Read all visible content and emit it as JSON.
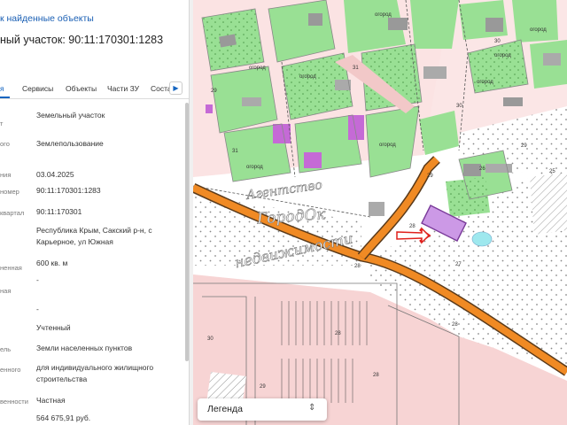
{
  "panel": {
    "back_link": "к найденные объекты",
    "parcel_title": "ный участок: 90:11:170301:1283",
    "tabs": [
      {
        "label": "я"
      },
      {
        "label": "Сервисы"
      },
      {
        "label": "Объекты"
      },
      {
        "label": "Части ЗУ"
      },
      {
        "label": "Соста"
      }
    ],
    "tabs_next_icon": "chevron-right-icon",
    "fields": [
      {
        "label": "т",
        "value": "Земельный участок"
      },
      {
        "label": "ого",
        "value": "Землепользование"
      },
      {
        "label": "ния",
        "value": "03.04.2025"
      },
      {
        "label": "номер",
        "value": "90:11:170301:1283"
      },
      {
        "label": "квартал",
        "value": "90:11:170301"
      },
      {
        "label": "",
        "value": "Республика Крым, Сакский р-н, с Карьерное, ул Южная"
      },
      {
        "label": "ненная",
        "value": "600 кв. м"
      },
      {
        "label": "ная",
        "value": "-"
      },
      {
        "label": "",
        "value": "-"
      },
      {
        "label": "",
        "value": "Учтенный"
      },
      {
        "label": "ель",
        "value": "Земли населенных пунктов"
      },
      {
        "label": "енного",
        "value": "для индивидуального жилищного строительства"
      },
      {
        "label": "венности",
        "value": "Частная"
      },
      {
        "label": "",
        "value": "564 675,91 руб."
      }
    ]
  },
  "map": {
    "legend_label": "Легенда",
    "legend_icon": "expand-collapse-icon",
    "watermark": [
      "Агентство",
      "ГородОк",
      "недвижимости"
    ],
    "labels": {
      "ogorod": "огород",
      "l1": "31",
      "l2": "29",
      "l3": "30",
      "l4": "31",
      "l5": "28",
      "l6": "26",
      "l7": "28",
      "l8": "27",
      "l9": "28",
      "l10": "30",
      "l11": "28",
      "l12": "29",
      "l13": "28",
      "l14": "29",
      "l15": "25",
      "l16": "29",
      "l17": "30"
    },
    "colors": {
      "garden": "#99e094",
      "parcel_pink": "#f5cccc",
      "road": "#f08a24",
      "selected_parcel": "#cc99e6",
      "arrow": "#e0201c"
    }
  }
}
